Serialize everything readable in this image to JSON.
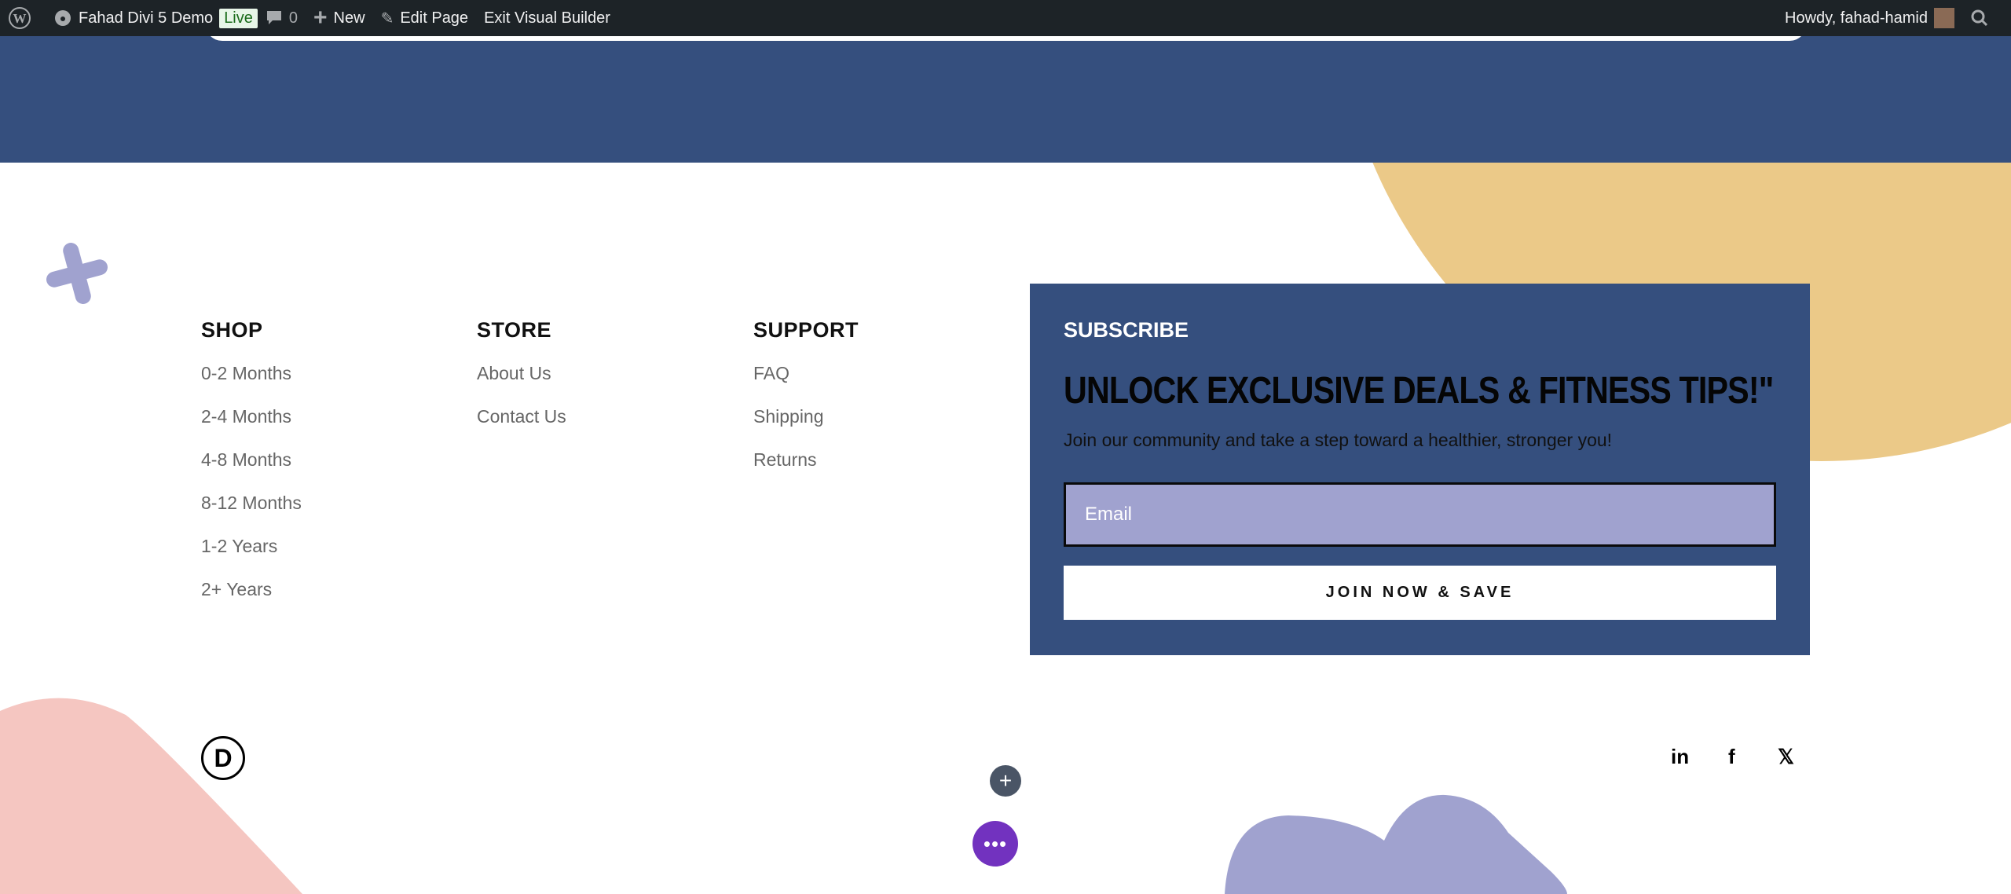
{
  "adminbar": {
    "site": "Fahad Divi 5 Demo",
    "live": "Live",
    "comments": "0",
    "new": "New",
    "edit": "Edit Page",
    "exit": "Exit Visual Builder",
    "howdy": "Howdy, fahad-hamid"
  },
  "footer": {
    "columns": [
      {
        "title": "SHOP",
        "links": [
          "0-2 Months",
          "2-4 Months",
          "4-8 Months",
          "8-12 Months",
          "1-2 Years",
          "2+ Years"
        ]
      },
      {
        "title": "STORE",
        "links": [
          "About Us",
          "Contact Us"
        ]
      },
      {
        "title": "SUPPORT",
        "links": [
          "FAQ",
          "Shipping",
          "Returns"
        ]
      }
    ],
    "subscribe": {
      "label": "SUBSCRIBE",
      "headline": "UNLOCK EXCLUSIVE DEALS & FITNESS TIPS!\"",
      "description": "Join our community and take a step toward a healthier, stronger you!",
      "email_placeholder": "Email",
      "button": "JOIN NOW & SAVE"
    },
    "logo": "D",
    "social": [
      "in",
      "f",
      "𝕏"
    ]
  },
  "builder": {
    "add": "+",
    "more": "•••"
  },
  "colors": {
    "navy": "#354f7e",
    "yellow": "#ebc988",
    "lavender": "#a0a2cf",
    "pink": "#f5c6c1",
    "purple": "#7232bf"
  }
}
